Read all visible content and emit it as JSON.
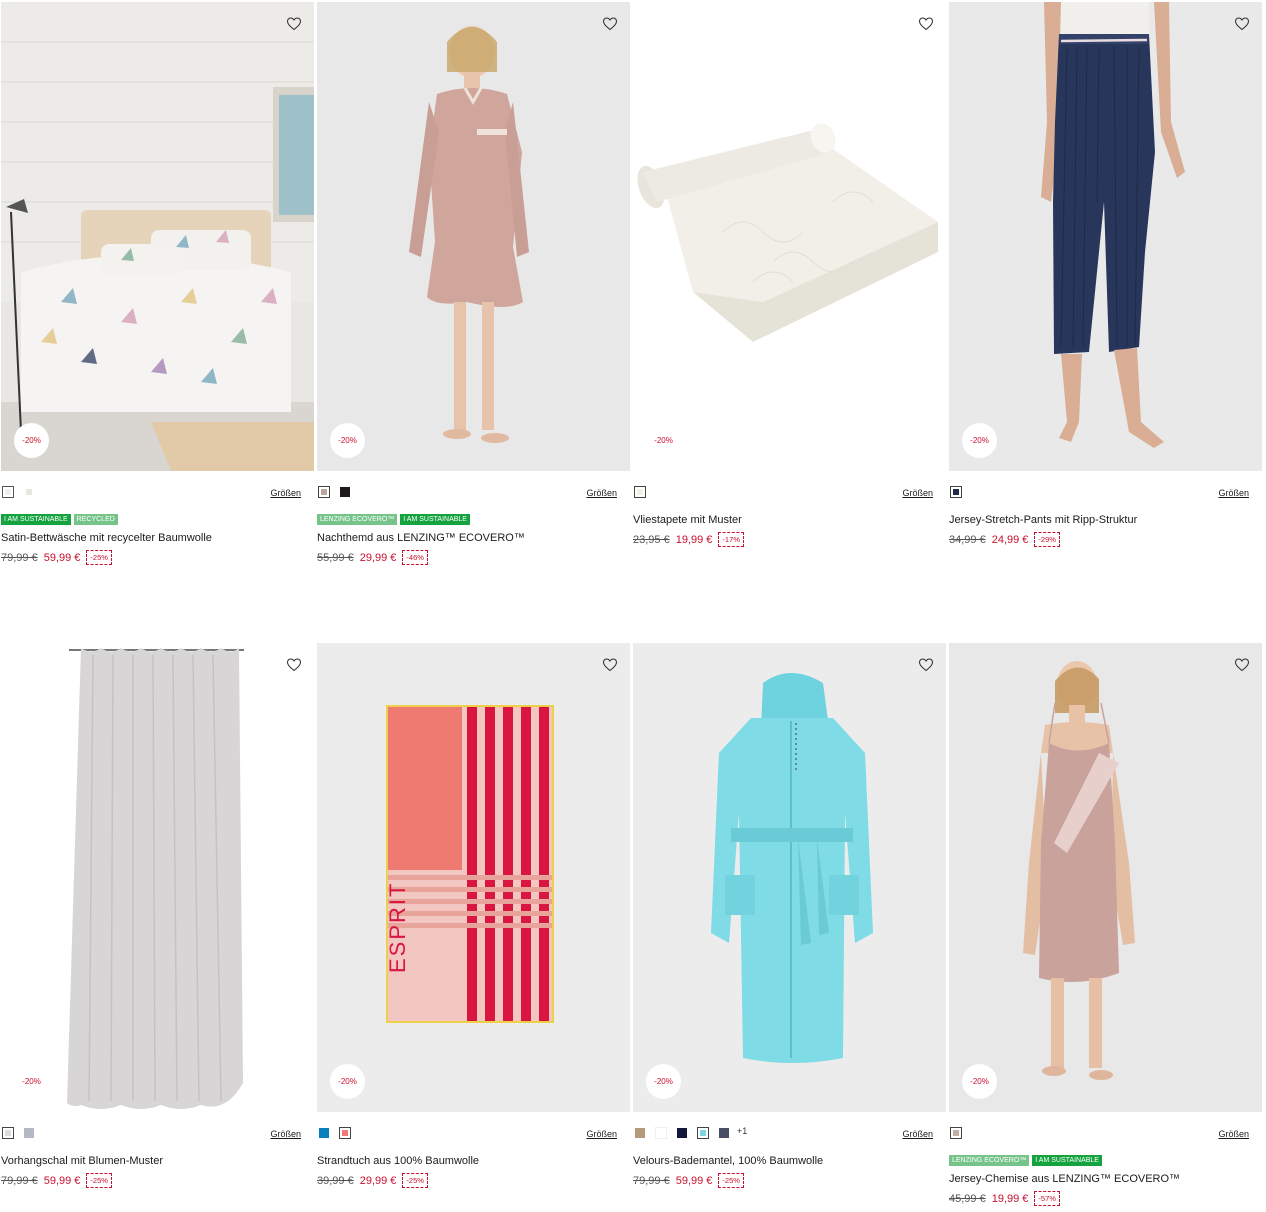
{
  "colors": {
    "sale": "#c8102e",
    "badge_sustainable": "#15a340",
    "badge_light": "#76c48a"
  },
  "products": [
    {
      "name": "Satin-Bettwäsche mit recycelter Baumwolle",
      "old_price": "79,99 €",
      "price": "59,99 €",
      "percent": "-25%",
      "discount_tag": "-20%",
      "sizes_label": "Größen",
      "badges": [
        "I AM SUSTAINABLE",
        "RECYCLED"
      ],
      "swatches": [
        "#efefef",
        "#f4f4ee"
      ],
      "more": ""
    },
    {
      "name": "Nachthemd aus LENZING™ ECOVERO™",
      "old_price": "55,99 €",
      "price": "29,99 €",
      "percent": "-46%",
      "discount_tag": "-20%",
      "sizes_label": "Größen",
      "badges": [
        "LENZING ECOVERO™",
        "I AM SUSTAINABLE"
      ],
      "swatches": [
        "#b9a79e",
        "#1e1a1a"
      ],
      "more": ""
    },
    {
      "name": "Vliestapete mit Muster",
      "old_price": "23,95 €",
      "price": "19,99 €",
      "percent": "-17%",
      "discount_tag": "-20%",
      "sizes_label": "Größen",
      "badges": [],
      "swatches": [
        "#f3f0e6"
      ],
      "more": ""
    },
    {
      "name": "Jersey-Stretch-Pants mit Ripp-Struktur",
      "old_price": "34,99 €",
      "price": "24,99 €",
      "percent": "-29%",
      "discount_tag": "-20%",
      "sizes_label": "Größen",
      "badges": [],
      "swatches": [
        "#1f2b48"
      ],
      "more": ""
    },
    {
      "name": "Vorhangschal mit Blumen-Muster",
      "old_price": "79,99 €",
      "price": "59,99 €",
      "percent": "-25%",
      "discount_tag": "-20%",
      "sizes_label": "Größen",
      "badges": [],
      "swatches": [
        "#dcdcdc",
        "#b4bac5"
      ],
      "more": ""
    },
    {
      "name": "Strandtuch aus 100% Baumwolle",
      "old_price": "39,99 €",
      "price": "29,99 €",
      "percent": "-25%",
      "discount_tag": "-20%",
      "sizes_label": "Größen",
      "badges": [],
      "swatches": [
        "#0a7fbf",
        "#ee7b74"
      ],
      "more": ""
    },
    {
      "name": "Velours-Bademantel, 100% Baumwolle",
      "old_price": "79,99 €",
      "price": "59,99 €",
      "percent": "-25%",
      "discount_tag": "-20%",
      "sizes_label": "Größen",
      "badges": [],
      "swatches": [
        "#b39a7a",
        "#ffffff",
        "#15183a",
        "#7ed4e0",
        "#4a4f66"
      ],
      "more": "+1"
    },
    {
      "name": "Jersey-Chemise aus LENZING™ ECOVERO™",
      "old_price": "45,99 €",
      "price": "19,99 €",
      "percent": "-57%",
      "discount_tag": "-20%",
      "sizes_label": "Größen",
      "badges": [
        "LENZING ECOVERO™",
        "I AM SUSTAINABLE"
      ],
      "swatches": [
        "#c2aea4"
      ],
      "more": ""
    }
  ]
}
